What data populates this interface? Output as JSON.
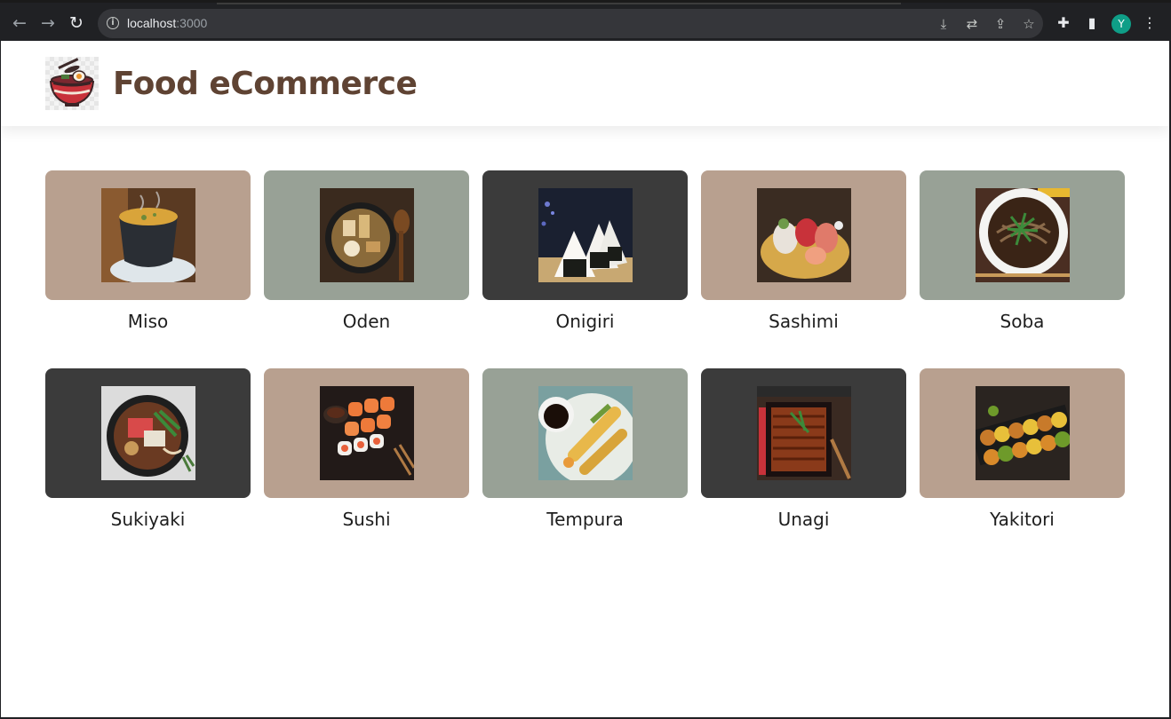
{
  "browser": {
    "url_host": "localhost",
    "url_port": ":3000",
    "profile_initial": "Y",
    "profile_color": "#0f9e87"
  },
  "header": {
    "title": "Food eCommerce",
    "logo_icon": "ramen-bowl-icon",
    "title_color": "#5f4333"
  },
  "palette": {
    "tan": "#b8a08f",
    "sage": "#98a196",
    "charcoal": "#3b3b3b"
  },
  "products": [
    {
      "name": "Miso",
      "bg": "#b8a08f"
    },
    {
      "name": "Oden",
      "bg": "#98a196"
    },
    {
      "name": "Onigiri",
      "bg": "#3b3b3b"
    },
    {
      "name": "Sashimi",
      "bg": "#b8a08f"
    },
    {
      "name": "Soba",
      "bg": "#98a196"
    },
    {
      "name": "Sukiyaki",
      "bg": "#3b3b3b"
    },
    {
      "name": "Sushi",
      "bg": "#b8a08f"
    },
    {
      "name": "Tempura",
      "bg": "#98a196"
    },
    {
      "name": "Unagi",
      "bg": "#3b3b3b"
    },
    {
      "name": "Yakitori",
      "bg": "#b8a08f"
    }
  ]
}
